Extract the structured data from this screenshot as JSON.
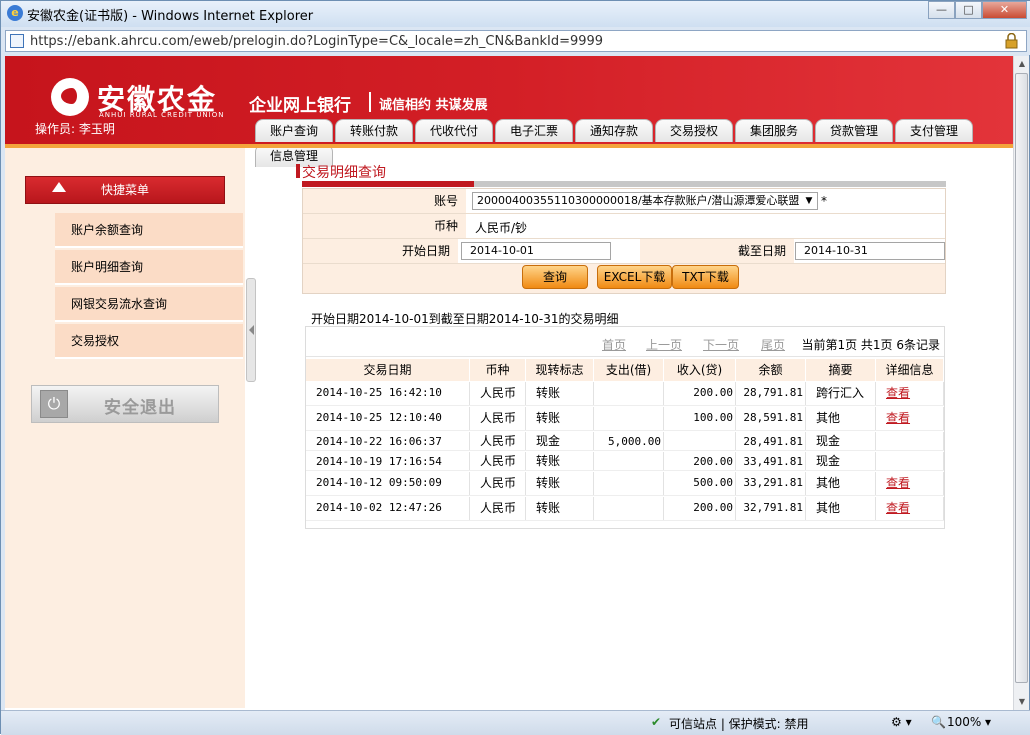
{
  "window": {
    "title": "安徽农金(证书版) - Windows Internet Explorer",
    "url": "https://ebank.ahrcu.com/eweb/prelogin.do?LoginType=C&_locale=zh_CN&BankId=9999"
  },
  "header": {
    "logo": "安徽农金",
    "logo_sub": "ANHUI RURAL CREDIT UNION",
    "title": "企业网上银行",
    "slogan": "诚信相约 共谋发展",
    "operator": "操作员:  李玉明",
    "tabs": [
      "账户查询",
      "转账付款",
      "代收代付",
      "电子汇票",
      "通知存款",
      "交易授权",
      "集团服务",
      "贷款管理",
      "支付管理",
      "信息管理"
    ]
  },
  "sidebar": {
    "quick_menu": "快捷菜单",
    "items": [
      "账户余额查询",
      "账户明细查询",
      "网银交易流水查询",
      "交易授权"
    ],
    "logout": "安全退出"
  },
  "form": {
    "title": "交易明细查询",
    "account_label": "账号",
    "account_value": "20000400355110300000018/基本存款账户/潜山源潭爱心联盟",
    "required_mark": "*",
    "currency_label": "币种",
    "currency_value": "人民币/钞",
    "start_label": "开始日期",
    "start_value": "2014-10-01",
    "end_label": "截至日期",
    "end_value": "2014-10-31",
    "buttons": [
      "查询",
      "EXCEL下载",
      "TXT下载"
    ]
  },
  "results": {
    "caption": "开始日期2014-10-01到截至日期2014-10-31的交易明细",
    "pager": {
      "first": "首页",
      "prev": "上一页",
      "next": "下一页",
      "last": "尾页",
      "info": "当前第1页 共1页 6条记录"
    },
    "columns": [
      "交易日期",
      "币种",
      "现转标志",
      "支出(借)",
      "收入(贷)",
      "余额",
      "摘要",
      "详细信息"
    ],
    "rows": [
      [
        "2014-10-25   16:42:10",
        "人民币",
        "转账",
        "",
        "200.00",
        "28,791.81",
        "跨行汇入",
        "查看"
      ],
      [
        "2014-10-25   12:10:40",
        "人民币",
        "转账",
        "",
        "100.00",
        "28,591.81",
        "其他",
        "查看"
      ],
      [
        "2014-10-22   16:06:37",
        "人民币",
        "现金",
        "5,000.00",
        "",
        "28,491.81",
        "现金",
        ""
      ],
      [
        "2014-10-19   17:16:54",
        "人民币",
        "转账",
        "",
        "200.00",
        "33,491.81",
        "现金",
        ""
      ],
      [
        "2014-10-12   09:50:09",
        "人民币",
        "转账",
        "",
        "500.00",
        "33,291.81",
        "其他",
        "查看"
      ],
      [
        "2014-10-02   12:47:26",
        "人民币",
        "转账",
        "",
        "200.00",
        "32,791.81",
        "其他",
        "查看"
      ]
    ]
  },
  "statusbar": {
    "trusted": "可信站点 | 保护模式: 禁用",
    "zoom": "100%"
  },
  "colors": {
    "brand_red": "#c6141c",
    "accent_orange": "#f3a43c",
    "menu_bg": "#fdeee1"
  }
}
